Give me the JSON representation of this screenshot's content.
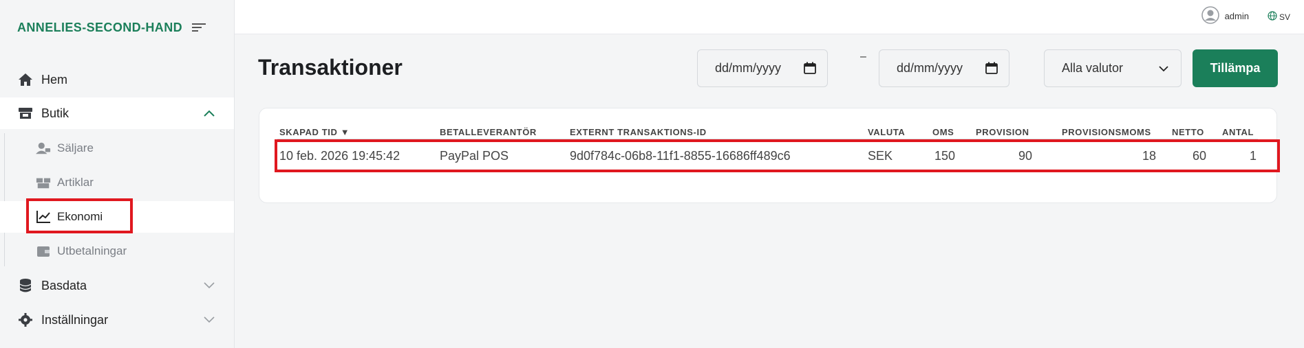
{
  "app": {
    "brand": "ANNELIES-SECOND-HAND"
  },
  "sidebar": {
    "items": [
      {
        "label": "Hem",
        "icon": "home-icon"
      },
      {
        "label": "Butik",
        "icon": "store-icon"
      },
      {
        "label": "Säljare",
        "icon": "sellers-icon"
      },
      {
        "label": "Artiklar",
        "icon": "boxes-icon"
      },
      {
        "label": "Ekonomi",
        "icon": "chart-line-icon"
      },
      {
        "label": "Utbetalningar",
        "icon": "wallet-icon"
      },
      {
        "label": "Basdata",
        "icon": "database-icon"
      },
      {
        "label": "Inställningar",
        "icon": "gear-icon"
      }
    ]
  },
  "topbar": {
    "user": "admin",
    "lang": "SV"
  },
  "page": {
    "title": "Transaktioner",
    "date_from_placeholder": "dd/mm/yyyy",
    "date_to_placeholder": "dd/mm/yyyy",
    "dash": "–",
    "currency_selected": "Alla valutor",
    "apply_label": "Tillämpa"
  },
  "table": {
    "headers": [
      "SKAPAD TID ▼",
      "BETALLEVERANTÖR",
      "EXTERNT TRANSAKTIONS-ID",
      "VALUTA",
      "OMS",
      "PROVISION",
      "PROVISIONSMOMS",
      "NETTO",
      "ANTAL"
    ],
    "rows": [
      [
        "10 feb. 2026 19:45:42",
        "PayPal POS",
        "9d0f784c-06b8-11f1-8855-16686ff489c6",
        "SEK",
        "150",
        "90",
        "18",
        "60",
        "1"
      ]
    ]
  },
  "colors": {
    "brand": "#1b7f5a",
    "highlight": "#e0181f"
  }
}
